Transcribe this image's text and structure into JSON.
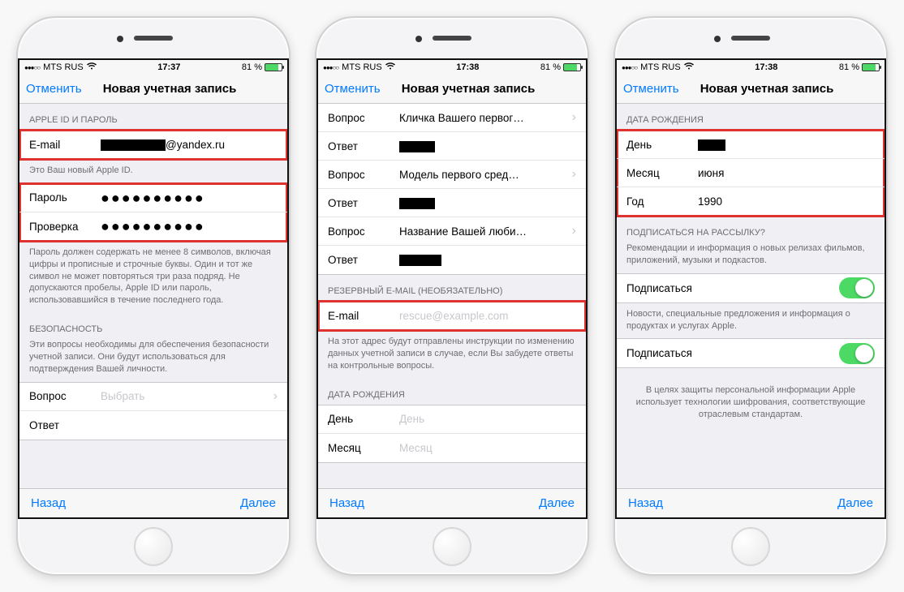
{
  "status": {
    "carrier": "MTS RUS",
    "battery_pct": "81 %"
  },
  "nav": {
    "cancel": "Отменить",
    "title": "Новая учетная запись"
  },
  "toolbar": {
    "back": "Назад",
    "next": "Далее"
  },
  "phone1": {
    "time": "17:37",
    "sec_appleid": "APPLE ID И ПАРОЛЬ",
    "email_label": "E-mail",
    "email_suffix": "@yandex.ru",
    "appleid_note": "Это Ваш новый Apple ID.",
    "password_label": "Пароль",
    "confirm_label": "Проверка",
    "password_note": "Пароль должен содержать не менее 8 символов, включая цифры и прописные и строчные буквы. Один и тот же символ не может повторяться три раза подряд. Не допускаются пробелы, Apple ID или пароль, использовавшийся в течение последнего года.",
    "sec_security": "БЕЗОПАСНОСТЬ",
    "security_note": "Эти вопросы необходимы для обеспечения безопасности учетной записи. Они будут использоваться для подтверждения Вашей личности.",
    "question_label": "Вопрос",
    "question_value": "Выбрать",
    "answer_label": "Ответ"
  },
  "phone2": {
    "time": "17:38",
    "q1_label": "Вопрос",
    "q1_value": "Кличка Вашего первог…",
    "a1_label": "Ответ",
    "q2_label": "Вопрос",
    "q2_value": "Модель первого сред…",
    "a2_label": "Ответ",
    "q3_label": "Вопрос",
    "q3_value": "Название Вашей люби…",
    "a3_label": "Ответ",
    "sec_rescue": "РЕЗЕРВНЫЙ E-MAIL (НЕОБЯЗАТЕЛЬНО)",
    "rescue_label": "E-mail",
    "rescue_placeholder": "rescue@example.com",
    "rescue_note": "На этот адрес будут отправлены инструкции по изменению данных учетной записи в случае, если Вы забудете ответы на контрольные вопросы.",
    "sec_dob": "ДАТА РОЖДЕНИЯ",
    "day_label": "День",
    "day_value": "День",
    "month_label": "Месяц",
    "month_value": "Месяц"
  },
  "phone3": {
    "time": "17:38",
    "sec_dob": "ДАТА РОЖДЕНИЯ",
    "day_label": "День",
    "month_label": "Месяц",
    "month_value": "июня",
    "year_label": "Год",
    "year_value": "1990",
    "sec_subscribe": "ПОДПИСАТЬСЯ НА РАССЫЛКУ?",
    "sub1_note": "Рекомендации и информация о новых релизах фильмов, приложений, музыки и подкастов.",
    "sub_label": "Подписаться",
    "sub2_note": "Новости, специальные предложения и информация о продуктах и услугах Apple.",
    "privacy_note": "В целях защиты персональной информации Apple использует технологии шифрования, соответствующие отраслевым стандартам."
  }
}
